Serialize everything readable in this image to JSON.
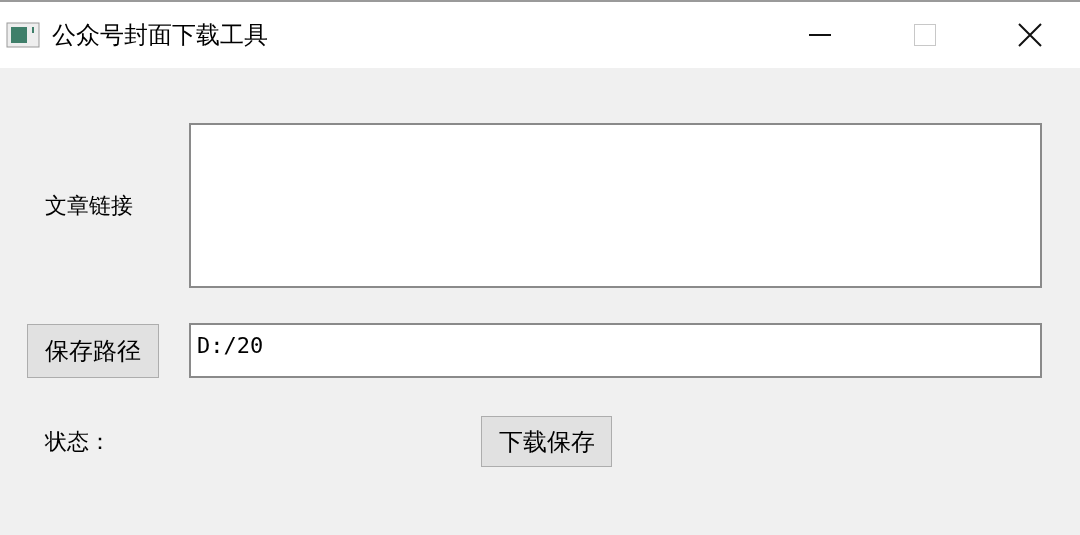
{
  "window": {
    "title": "公众号封面下载工具",
    "maximize_disabled": true
  },
  "link_field": {
    "label": "文章链接"
  },
  "save_path": {
    "button": "保存路径",
    "value": "D:/20"
  },
  "status": {
    "label": "状态："
  },
  "download_button": "下载保存"
}
